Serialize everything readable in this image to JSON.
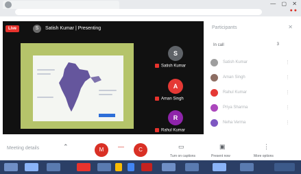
{
  "meet": {
    "live_badge": "Live",
    "presenter_initial": "S",
    "presenter_name": "Satish Kumar | Presenting",
    "participants_title": "Participants",
    "participants_count": "3",
    "section_label": "In call",
    "tiles": [
      {
        "initial": "S",
        "name": "Satish Kumar",
        "color": "#5f6368"
      },
      {
        "initial": "A",
        "name": "Aman Singh",
        "color": "#e53935"
      },
      {
        "initial": "R",
        "name": "Rahul Kumar",
        "color": "#8e24aa"
      }
    ],
    "participants": [
      {
        "name": "Satish Kumar",
        "color": "#9e9e9e"
      },
      {
        "name": "Aman Singh",
        "color": "#8d6e63"
      },
      {
        "name": "Rahul Kumar",
        "color": "#e53935"
      },
      {
        "name": "Priya Sharma",
        "color": "#ab47bc"
      },
      {
        "name": "Neha Verma",
        "color": "#7e57c2"
      }
    ]
  },
  "controls": {
    "meeting_details": "Meeting details",
    "mic_label": "M",
    "cam_label": "C",
    "present_label": "Present now",
    "captions_label": "Turn on captions",
    "more_label": "More options"
  },
  "colors": {
    "accent_red": "#d93025",
    "slide_bg": "#b5c46a",
    "taskbar": "#2b3f66"
  }
}
